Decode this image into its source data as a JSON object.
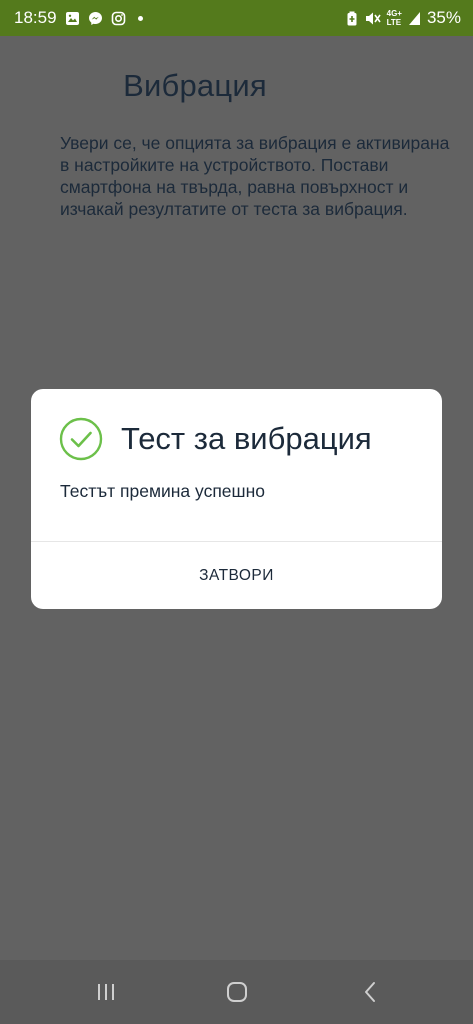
{
  "status_bar": {
    "time": "18:59",
    "battery_percent": "35%",
    "network_label_top": "4G+",
    "network_label_bottom": "LTE",
    "color": "#547a1c",
    "icons_left": [
      "gallery-icon",
      "messenger-icon",
      "instagram-icon",
      "notification-dot-icon"
    ],
    "icons_right": [
      "battery-saver-icon",
      "mute-vibrate-icon",
      "network-icon",
      "signal-icon"
    ]
  },
  "page": {
    "title": "Вибрация",
    "description": "Увери се, че опцията за вибрация е активирана в настройките на устройството. Постави смартфона на твърда, равна повърхност и изчакай резултатите от теста за вибрация."
  },
  "dialog": {
    "title": "Тест за вибрация",
    "message": "Тестът премина успешно",
    "close_label": "ЗАТВОРИ",
    "icon": "check-circle-icon",
    "accent_color": "#6cc04a"
  },
  "nav_bar": {
    "buttons": [
      "recent-apps-icon",
      "home-icon",
      "back-icon"
    ]
  }
}
